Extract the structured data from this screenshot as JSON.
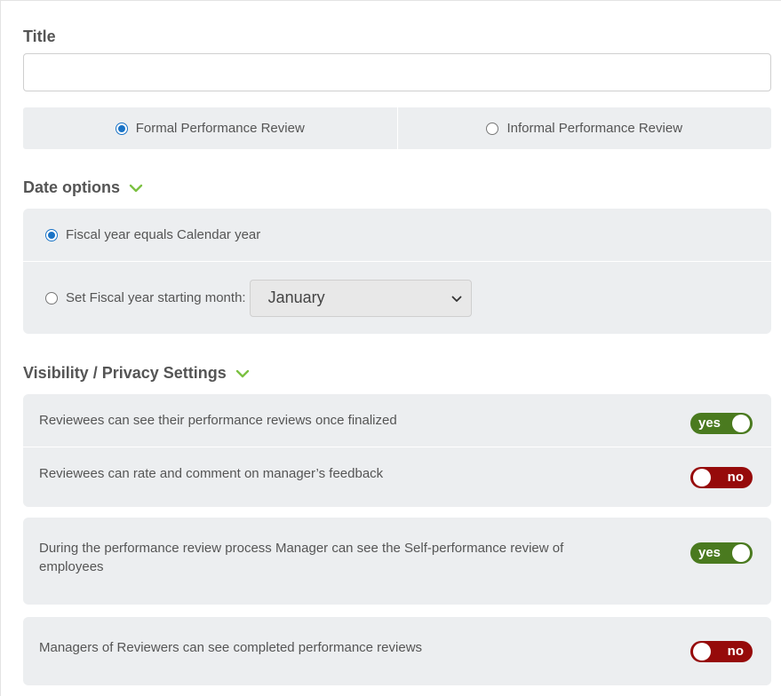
{
  "title_field": {
    "label": "Title",
    "value": "",
    "placeholder": ""
  },
  "review_type": {
    "options": [
      {
        "label": "Formal Performance Review",
        "checked": true
      },
      {
        "label": "Informal Performance Review",
        "checked": false
      }
    ]
  },
  "date_options": {
    "heading": "Date options",
    "fiscal_equals_calendar": {
      "label": "Fiscal year equals Calendar year",
      "checked": true
    },
    "fiscal_start": {
      "label": "Set Fiscal year starting month:",
      "checked": false,
      "selected_month": "January"
    }
  },
  "visibility": {
    "heading": "Visibility / Privacy Settings",
    "settings": [
      {
        "text": "Reviewees can see their performance reviews once finalized",
        "state": "yes"
      },
      {
        "text": "Reviewees can rate and comment on manager’s feedback",
        "state": "no"
      },
      {
        "text": "During the performance review process Manager can see the Self-performance review of employees",
        "state": "yes"
      },
      {
        "text": "Managers of Reviewers can see completed performance reviews",
        "state": "no"
      }
    ]
  },
  "colors": {
    "accent_blue": "#1a73c6",
    "toggle_yes": "#4a7a1f",
    "toggle_no": "#960a0a",
    "chevron_green": "#7cc142",
    "panel_bg": "#eceef0"
  },
  "icons": {
    "section_chevron": "chevron-down-icon",
    "select_caret": "chevron-down-icon"
  }
}
